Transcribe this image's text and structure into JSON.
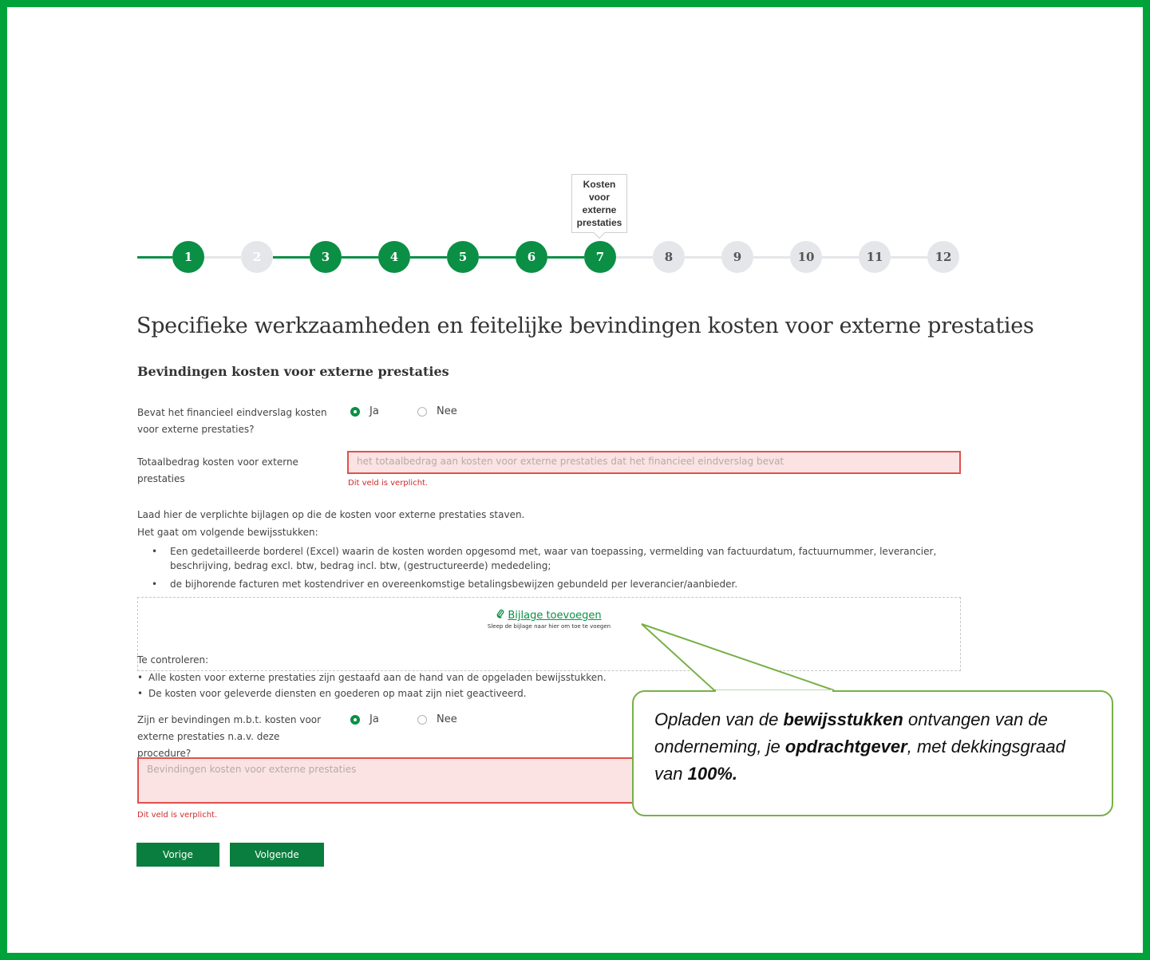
{
  "stepper": {
    "tooltip": "Kosten voor externe prestaties",
    "steps": [
      {
        "label": "1",
        "state": "done"
      },
      {
        "label": "2",
        "state": "skip"
      },
      {
        "label": "3",
        "state": "done"
      },
      {
        "label": "4",
        "state": "done"
      },
      {
        "label": "5",
        "state": "done"
      },
      {
        "label": "6",
        "state": "done"
      },
      {
        "label": "7",
        "state": "current"
      },
      {
        "label": "8",
        "state": "todo"
      },
      {
        "label": "9",
        "state": "todo"
      },
      {
        "label": "10",
        "state": "todo"
      },
      {
        "label": "11",
        "state": "todo"
      },
      {
        "label": "12",
        "state": "todo"
      }
    ]
  },
  "page": {
    "title": "Specifieke werkzaamheden en feitelijke bevindingen kosten voor externe prestaties",
    "section_title": "Bevindingen kosten voor externe prestaties"
  },
  "q1": {
    "label": "Bevat het financieel eindverslag kosten voor externe prestaties?",
    "option_yes": "Ja",
    "option_no": "Nee",
    "selected": "Ja"
  },
  "total": {
    "label": "Totaalbedrag kosten voor externe prestaties",
    "placeholder": "het totaalbedrag aan kosten voor externe prestaties dat het financieel eindverslag bevat",
    "error": "Dit veld is verplicht."
  },
  "attachments": {
    "intro": "Laad hier de verplichte bijlagen op die de kosten voor externe prestaties staven.",
    "intro2": "Het gaat om volgende bewijsstukken:",
    "items": [
      "Een gedetailleerde borderel (Excel) waarin de kosten worden opgesomd met, waar van toepassing, vermelding van factuurdatum, factuurnummer, leverancier, beschrijving, bedrag excl. btw, bedrag incl. btw, (gestructureerde) mededeling;",
      "de bijhorende facturen met kostendriver en overeenkomstige betalingsbewijzen gebundeld per leverancier/aanbieder."
    ],
    "add_link": "Bijlage toevoegen",
    "drop_hint": "Sleep de bijlage naar hier om toe te voegen"
  },
  "check": {
    "title": "Te controleren:",
    "items": [
      "Alle kosten voor externe prestaties zijn gestaafd aan de hand van de opgeladen bewijsstukken.",
      "De kosten voor geleverde diensten en goederen op maat zijn niet geactiveerd."
    ]
  },
  "q2": {
    "label": "Zijn er bevindingen m.b.t. kosten voor externe prestaties n.a.v. deze procedure?",
    "option_yes": "Ja",
    "option_no": "Nee",
    "selected": "Ja"
  },
  "findings": {
    "placeholder": "Bevindingen kosten voor externe prestaties",
    "error": "Dit veld is verplicht."
  },
  "buttons": {
    "prev": "Vorige",
    "next": "Volgende"
  },
  "callout": {
    "t1": "Opladen van de ",
    "b1": "bewijsstukken",
    "t2": " ontvangen van de onderneming, je ",
    "b2": "opdrachtgever",
    "t3": ", met dekkingsgraad van ",
    "b3": "100%."
  },
  "colors": {
    "frame": "#00a33a",
    "step_done": "#0a8f45",
    "step_todo": "#e4e6e9",
    "error": "#d0292b",
    "callout_border": "#78b046"
  },
  "icons": {
    "attach": "paperclip-icon"
  }
}
